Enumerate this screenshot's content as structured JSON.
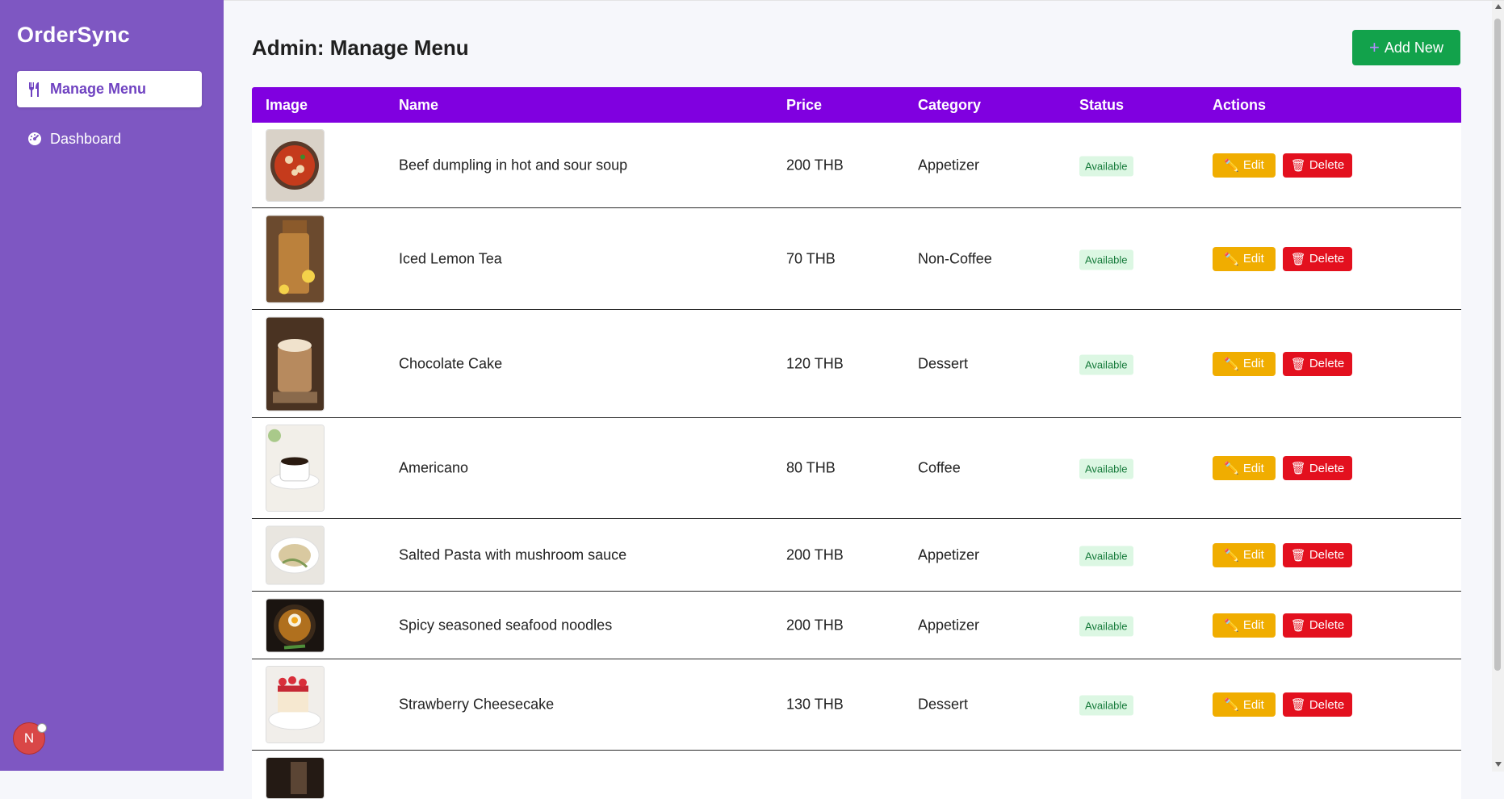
{
  "sidebar": {
    "brand": "OrderSync",
    "items": [
      {
        "label": "Manage Menu",
        "icon": "utensils-icon",
        "active": true
      },
      {
        "label": "Dashboard",
        "icon": "gauge-icon",
        "active": false
      }
    ],
    "avatar_initial": "N"
  },
  "header": {
    "title": "Admin: Manage Menu",
    "add_label": "Add New"
  },
  "table": {
    "columns": [
      "Image",
      "Name",
      "Price",
      "Category",
      "Status",
      "Actions"
    ],
    "edit_label": "Edit",
    "delete_label": "Delete",
    "rows": [
      {
        "name": "Beef dumpling in hot and sour soup",
        "price": "200 THB",
        "category": "Appetizer",
        "status": "Available",
        "image": "soup-image"
      },
      {
        "name": "Iced Lemon Tea",
        "price": "70 THB",
        "category": "Non-Coffee",
        "status": "Available",
        "image": "iced-tea-image"
      },
      {
        "name": "Chocolate Cake",
        "price": "120 THB",
        "category": "Dessert",
        "status": "Available",
        "image": "mocha-drink-image"
      },
      {
        "name": "Americano",
        "price": "80 THB",
        "category": "Coffee",
        "status": "Available",
        "image": "coffee-cup-image"
      },
      {
        "name": "Salted Pasta with mushroom sauce",
        "price": "200 THB",
        "category": "Appetizer",
        "status": "Available",
        "image": "pasta-image"
      },
      {
        "name": "Spicy seasoned seafood noodles",
        "price": "200 THB",
        "category": "Appetizer",
        "status": "Available",
        "image": "noodle-bowl-image"
      },
      {
        "name": "Strawberry Cheesecake",
        "price": "130 THB",
        "category": "Dessert",
        "status": "Available",
        "image": "cheesecake-image"
      }
    ]
  },
  "colors": {
    "sidebar": "#7e57c2",
    "header_row": "#8000e0",
    "add_button": "#12a24b",
    "edit_button": "#f0ad00",
    "delete_button": "#e3101e",
    "badge_bg": "#dcf7e3"
  }
}
